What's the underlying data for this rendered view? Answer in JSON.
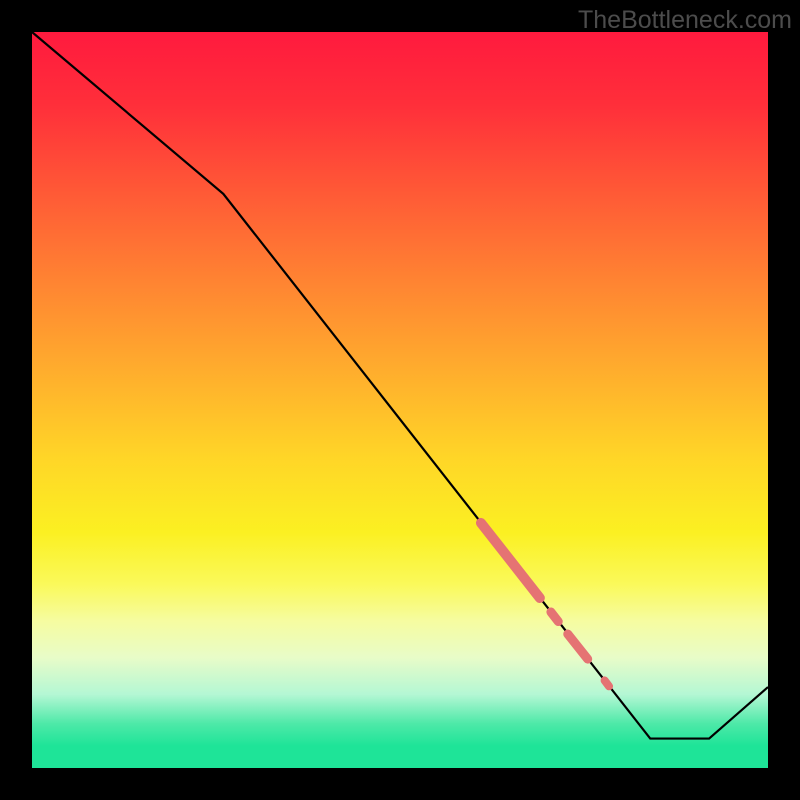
{
  "watermark": "TheBottleneck.com",
  "chart_data": {
    "type": "line",
    "title": "",
    "xlabel": "",
    "ylabel": "",
    "xlim": [
      0,
      100
    ],
    "ylim": [
      0,
      100
    ],
    "grid": false,
    "legend": false,
    "series": [
      {
        "name": "curve",
        "color": "#000000",
        "x": [
          0,
          26,
          84,
          92,
          100
        ],
        "y": [
          100,
          78,
          4,
          4,
          11
        ]
      }
    ],
    "highlights": [
      {
        "name": "segment-a",
        "x0": 61.0,
        "y0": 33.3,
        "x1": 69.0,
        "y1": 23.1,
        "width": 10
      },
      {
        "name": "dot-b",
        "x0": 70.5,
        "y0": 21.2,
        "x1": 71.5,
        "y1": 19.9,
        "width": 9
      },
      {
        "name": "segment-c",
        "x0": 72.8,
        "y0": 18.2,
        "x1": 75.5,
        "y1": 14.8,
        "width": 9
      },
      {
        "name": "dot-d",
        "x0": 77.8,
        "y0": 11.9,
        "x1": 78.4,
        "y1": 11.1,
        "width": 8
      }
    ],
    "highlight_color": "#e57373",
    "background": "gradient-red-to-green"
  }
}
